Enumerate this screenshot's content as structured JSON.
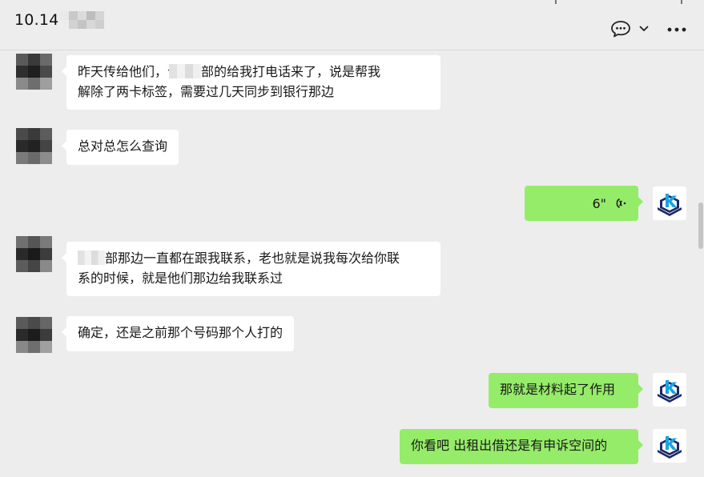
{
  "header": {
    "title": "10.14",
    "chat_icon": "chat-bubble-icon",
    "chevron_icon": "chevron-down-icon",
    "more_icon": "more-dots-icon"
  },
  "colors": {
    "background": "#ededed",
    "incoming_bubble": "#ffffff",
    "outgoing_bubble": "#95ec69",
    "text": "#181818"
  },
  "messages": [
    {
      "direction": "incoming",
      "line1_a": "昨天传给他们，今天",
      "line1_b": "部的给我打电话来了，说是帮我",
      "line2": "解除了两卡标签，需要过几天同步到银行那边"
    },
    {
      "direction": "incoming",
      "text": "总对总怎么查询"
    },
    {
      "direction": "outgoing",
      "type": "voice",
      "duration": "6\"",
      "icon": "voice-wave-icon"
    },
    {
      "direction": "incoming",
      "line1_b": "部那边一直都在跟我联系，老也就是说我每次给你联",
      "line2": "系的时候，就是他们那边给我联系过"
    },
    {
      "direction": "incoming",
      "text": "确定，还是之前那个号码那个人打的"
    },
    {
      "direction": "outgoing",
      "text": "那就是材料起了作用"
    },
    {
      "direction": "outgoing",
      "text": "你看吧 出租出借还是有申诉空间的"
    }
  ],
  "avatars": {
    "incoming": "blurred-avatar",
    "outgoing": "k-logo-avatar"
  }
}
